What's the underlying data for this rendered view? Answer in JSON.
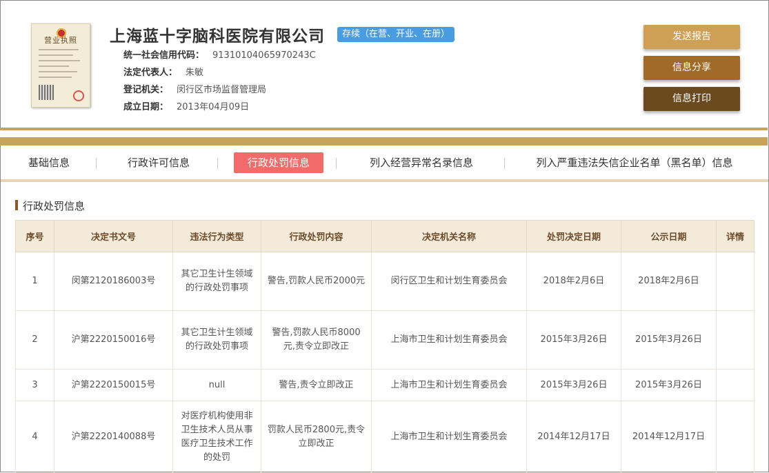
{
  "company": {
    "license_label": "营业执照",
    "name": "上海蓝十字脑科医院有限公司",
    "status": "存续（在营、开业、在册）",
    "fields": [
      {
        "label": "统一社会信用代码：",
        "value": "91310104065970243C"
      },
      {
        "label": "法定代表人：",
        "value": "朱敏"
      },
      {
        "label": "登记机关：",
        "value": "闵行区市场监督管理局"
      },
      {
        "label": "成立日期：",
        "value": "2013年04月09日"
      }
    ]
  },
  "actions": {
    "report": "发送报告",
    "share": "信息分享",
    "print": "信息打印"
  },
  "tabs": [
    {
      "label": "基础信息",
      "active": false
    },
    {
      "label": "行政许可信息",
      "active": false
    },
    {
      "label": "行政处罚信息",
      "active": true
    },
    {
      "label": "列入经营异常名录信息",
      "active": false
    },
    {
      "label": "列入严重违法失信企业名单（黑名单）信息",
      "active": false
    }
  ],
  "section": {
    "title": "行政处罚信息"
  },
  "table": {
    "columns": [
      "序号",
      "决定书文号",
      "违法行为类型",
      "行政处罚内容",
      "决定机关名称",
      "处罚决定日期",
      "公示日期",
      "详情"
    ],
    "rows": [
      {
        "no": "1",
        "doc": "闵第2120186003号",
        "type": "其它卫生计生领域的行政处罚事项",
        "content": "警告,罚款人民币2000元",
        "authority": "闵行区卫生和计划生育委员会",
        "decision_date": "2018年2月6日",
        "publish_date": "2018年2月6日",
        "detail": ""
      },
      {
        "no": "2",
        "doc": "沪第2220150016号",
        "type": "其它卫生计生领域的行政处罚事项",
        "content": "警告,罚款人民币8000元,责令立即改正",
        "authority": "上海市卫生和计划生育委员会",
        "decision_date": "2015年3月26日",
        "publish_date": "2015年3月26日",
        "detail": ""
      },
      {
        "no": "3",
        "doc": "沪第2220150015号",
        "type": "null",
        "content": "警告,责令立即改正",
        "authority": "上海市卫生和计划生育委员会",
        "decision_date": "2015年3月26日",
        "publish_date": "2015年3月26日",
        "detail": ""
      },
      {
        "no": "4",
        "doc": "沪第2220140088号",
        "type": "对医疗机构使用非卫生技术人员从事医疗卫生技术工作的处罚",
        "content": "罚款人民币2800元,责令立即改正",
        "authority": "上海市卫生和计划生育委员会",
        "decision_date": "2014年12月17日",
        "publish_date": "2014年12月17日",
        "detail": ""
      }
    ]
  },
  "colors": {
    "gold_band": "#c9a25a",
    "active_tab": "#f26b6b",
    "status_badge": "#4a9ce0",
    "btn_report": "#cf9f55",
    "btn_share": "#a06a28",
    "btn_print": "#6b4a1f",
    "table_header_bg": "#f4ead9"
  }
}
